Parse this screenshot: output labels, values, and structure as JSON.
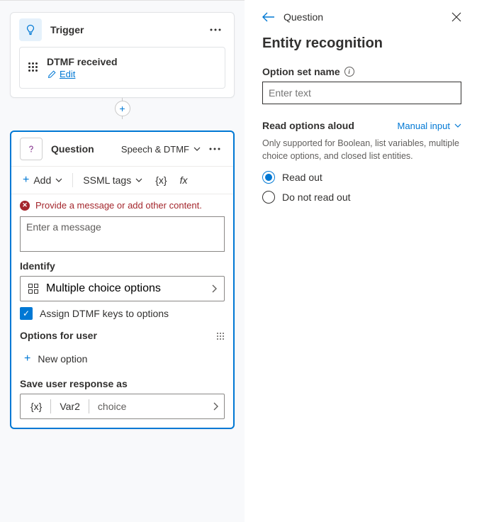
{
  "canvas": {
    "trigger": {
      "label": "Trigger",
      "item_title": "DTMF received",
      "edit_label": "Edit"
    },
    "question": {
      "label": "Question",
      "mode": "Speech & DTMF",
      "toolbar": {
        "add": "Add",
        "ssml": "SSML tags",
        "var": "{x}",
        "fx": "fx"
      },
      "error": "Provide a message or add other content.",
      "message_placeholder": "Enter a message",
      "identify_label": "Identify",
      "identify_value": "Multiple choice options",
      "assign_dtmf": "Assign DTMF keys to options",
      "options_label": "Options for user",
      "new_option": "New option",
      "save_label": "Save user response as",
      "variable_name": "Var2",
      "variable_type": "choice",
      "var_icon": "{x}"
    }
  },
  "panel": {
    "breadcrumb": "Question",
    "title": "Entity recognition",
    "option_set_name_label": "Option set name",
    "option_set_name_placeholder": "Enter text",
    "read_options_label": "Read options aloud",
    "manual_input": "Manual input",
    "help_text": "Only supported for Boolean, list variables, multiple choice options, and closed list entities.",
    "radio_read_out": "Read out",
    "radio_do_not": "Do not read out"
  }
}
